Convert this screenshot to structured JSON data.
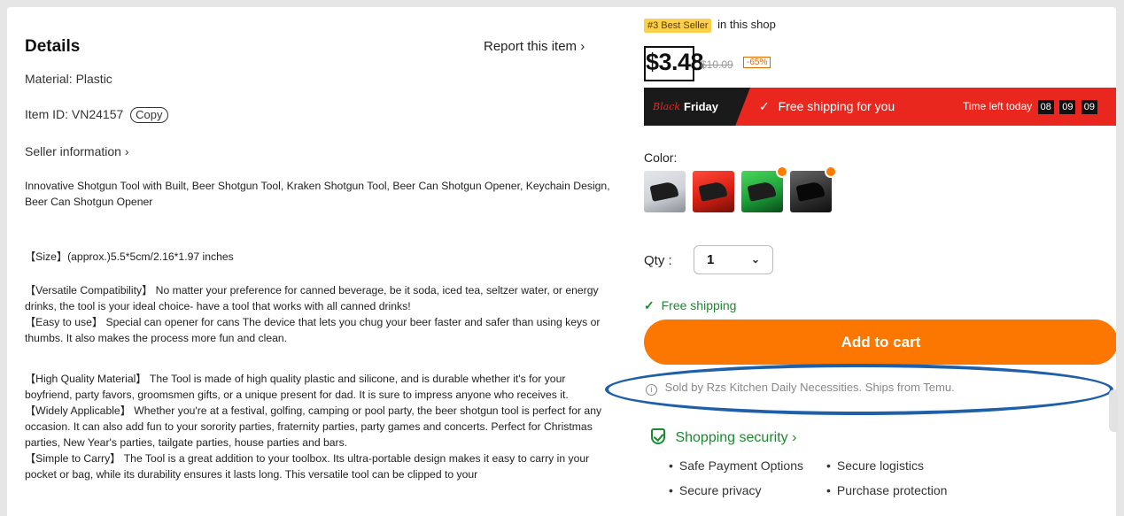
{
  "left": {
    "title": "Details",
    "report_link": "Report this item",
    "material": "Material: Plastic",
    "item_id": "Item ID: VN24157",
    "copy_label": "Copy",
    "seller_info": "Seller information",
    "summary": "Innovative Shotgun Tool with Built, Beer Shotgun Tool, Kraken Shotgun Tool, Beer Can Shotgun Opener, Keychain Design, Beer Can Shotgun Opener",
    "size": "【Size】(approx.)5.5*5cm/2.16*1.97 inches",
    "compat": "【Versatile Compatibility】 No matter your preference for canned beverage, be it soda, iced tea, seltzer water, or energy drinks, the tool is your ideal choice- have a tool that works with all canned drinks!",
    "easy": "【Easy to use】 Special can opener for cans The device that lets you chug your beer faster and safer than using keys or thumbs. It also makes the process more fun and clean.",
    "quality": "【High Quality Material】 The Tool is made of high quality plastic and silicone, and is durable whether it's for your boyfriend, party favors, groomsmen gifts, or a unique present for dad. It is sure to impress anyone who receives it.",
    "applicable": "【Widely Applicable】 Whether you're at a festival, golfing, camping or pool party, the beer shotgun tool is perfect for any occasion. It can also add fun to your sorority parties, fraternity parties, party games and concerts. Perfect for Christmas parties, New Year's parties, tailgate parties, house parties and bars.",
    "carry": "【Simple to Carry】 The Tool is a great addition to your toolbox. Its ultra-portable design makes it easy to carry in your pocket or bag, while its durability ensures it lasts long. This versatile tool can be clipped to your"
  },
  "right": {
    "bestseller_badge": "#3 Best Seller",
    "bestseller_suffix": "in this shop",
    "price": "$3.48",
    "old_price": "$10.09",
    "discount": "-65%",
    "promo": {
      "black": "Black",
      "friday": "Friday",
      "shipping_msg": "Free shipping for you",
      "time_left_label": "Time left today",
      "hours": "08",
      "minutes": "09",
      "seconds": "09"
    },
    "color_label": "Color:",
    "swatch_names": [
      "white",
      "red",
      "green",
      "black"
    ],
    "qty_label": "Qty :",
    "qty_value": "1",
    "free_shipping": "Free shipping",
    "add_to_cart": "Add to cart",
    "sold_by": "Sold by Rzs Kitchen Daily Necessities. Ships from Temu.",
    "security_title": "Shopping security",
    "security_items": [
      "Safe Payment Options",
      "Secure logistics",
      "Secure privacy",
      "Purchase protection"
    ]
  },
  "colors": {
    "accent_orange": "#fb7701",
    "promo_red": "#e9271f",
    "success_green": "#1b8a2e",
    "annotation_blue": "#1e5fa8"
  }
}
